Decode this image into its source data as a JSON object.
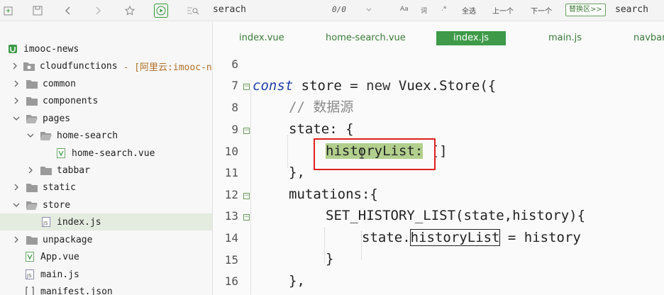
{
  "toolbar": {
    "search_query": "serach",
    "match_count": "0/0",
    "case_label": "Aa",
    "word_label": "词",
    "regex_label": ".*",
    "select_all_label": "全选",
    "prev_label": "上一个",
    "next_label": "下一个",
    "replace_button_label": "替换区>>",
    "replace_query": "search"
  },
  "sidebar": {
    "items": [
      {
        "label": "imooc-news",
        "suffix": ""
      },
      {
        "label": "cloudfunctions",
        "suffix": "- [阿里云:imooc-ne"
      },
      {
        "label": "common",
        "suffix": ""
      },
      {
        "label": "components",
        "suffix": ""
      },
      {
        "label": "pages",
        "suffix": ""
      },
      {
        "label": "home-search",
        "suffix": ""
      },
      {
        "label": "home-search.vue",
        "suffix": ""
      },
      {
        "label": "tabbar",
        "suffix": ""
      },
      {
        "label": "static",
        "suffix": ""
      },
      {
        "label": "store",
        "suffix": ""
      },
      {
        "label": "index.js",
        "suffix": ""
      },
      {
        "label": "unpackage",
        "suffix": ""
      },
      {
        "label": "App.vue",
        "suffix": ""
      },
      {
        "label": "main.js",
        "suffix": ""
      },
      {
        "label": "manifest.json",
        "suffix": ""
      }
    ]
  },
  "editor": {
    "tabs": [
      {
        "label": "index.vue"
      },
      {
        "label": "home-search.vue"
      },
      {
        "label": "index.js"
      },
      {
        "label": "main.js"
      },
      {
        "label": "navbar"
      }
    ],
    "line_numbers": [
      "6",
      "7",
      "8",
      "9",
      "10",
      "11",
      "12",
      "13",
      "14",
      "15",
      "16"
    ],
    "code": {
      "l7_kw": "const",
      "l7_mid": " store = ",
      "l7_new": "new",
      "l7_rest": " Vuex.Store({",
      "l8": "// 数据源",
      "l9": "state: {",
      "l10_hl": "historyList",
      "l10_colon": ":",
      "l10_rest": " []",
      "l11": "},",
      "l12": "mutations:{",
      "l13": "SET_HISTORY_LIST(state,history){",
      "l14_pre": "state.",
      "l14_box": "historyList",
      "l14_post": " = history",
      "l15": "}",
      "l16": "},"
    }
  }
}
